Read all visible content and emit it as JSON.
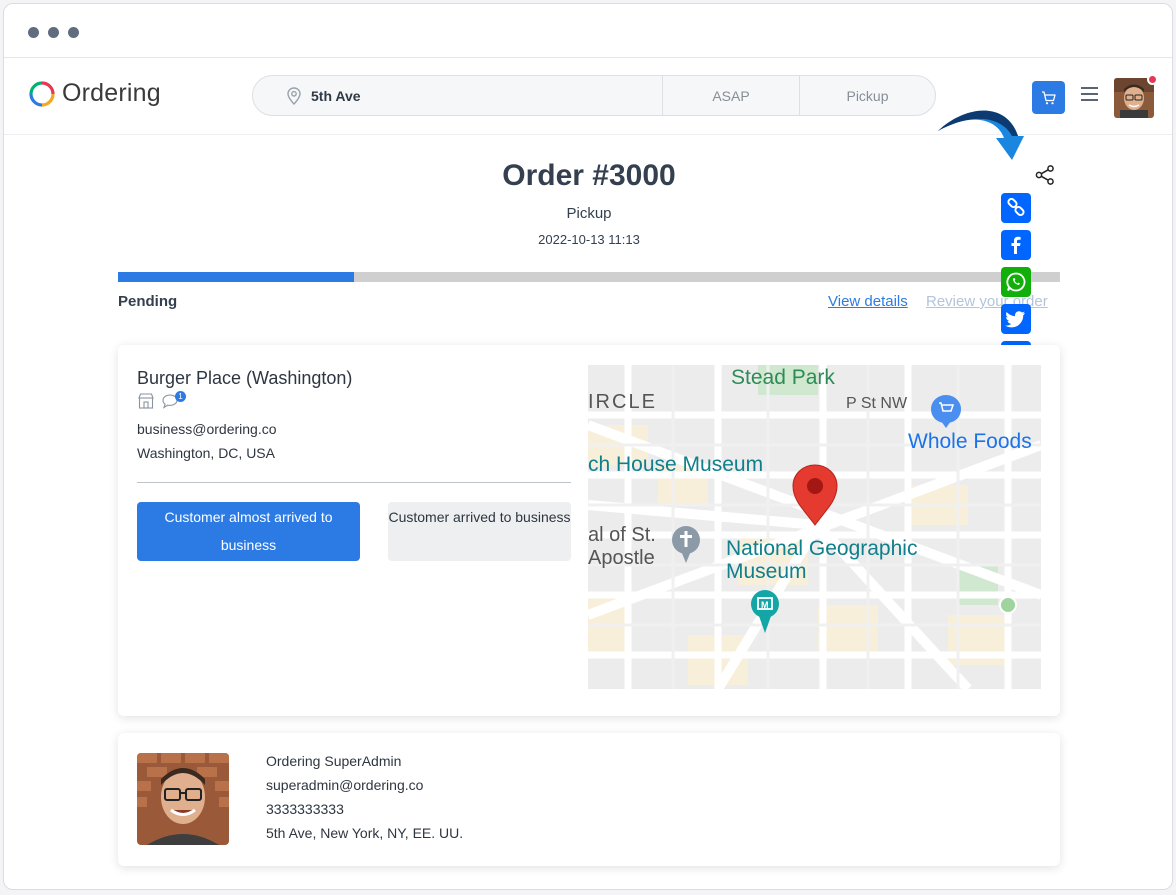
{
  "header": {
    "logo_text": "Ordering",
    "address": "5th Ave",
    "time": "ASAP",
    "order_type": "Pickup"
  },
  "order": {
    "title": "Order #3000",
    "type": "Pickup",
    "date": "2022-10-13 11:13",
    "status": "Pending",
    "progress": 0.25,
    "view_details": "View details",
    "review_order": "Review your order"
  },
  "share": {
    "items": [
      "copy-link",
      "facebook",
      "whatsapp",
      "twitter",
      "email",
      "more"
    ],
    "colors": {
      "copy": "#0166ff",
      "facebook": "#0166ff",
      "whatsapp": "#12af0a",
      "twitter": "#0166ff",
      "email": "#0166ff",
      "more": "#0166ff"
    }
  },
  "business": {
    "name": "Burger Place (Washington)",
    "notification_count": "1",
    "email": "business@ordering.co",
    "location": "Washington, DC, USA",
    "btn_almost_arrived": "Customer almost arrived to business",
    "btn_arrived": "Customer arrived to business"
  },
  "map": {
    "labels": [
      "Stead Park",
      "IRCLE",
      "P St NW",
      "Whole Foods",
      "ch House Museum",
      "al of St.",
      "Apostle",
      "National Geographic",
      "Museum"
    ]
  },
  "customer": {
    "name": "Ordering SuperAdmin",
    "email": "superadmin@ordering.co",
    "phone": "3333333333",
    "address": "5th Ave, New York, NY, EE. UU."
  },
  "colors": {
    "primary": "#2c7be5",
    "text": "#344050",
    "notification": "#e63757"
  }
}
